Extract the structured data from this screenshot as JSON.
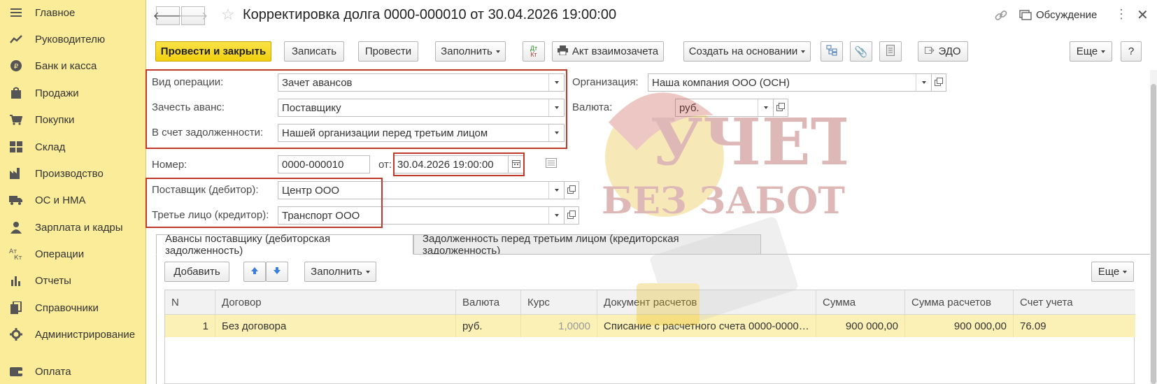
{
  "sidebar": {
    "items": [
      {
        "label": "Главное",
        "icon": "menu-icon"
      },
      {
        "label": "Руководителю",
        "icon": "trend-icon"
      },
      {
        "label": "Банк и касса",
        "icon": "coin-icon"
      },
      {
        "label": "Продажи",
        "icon": "bag-icon"
      },
      {
        "label": "Покупки",
        "icon": "cart-icon"
      },
      {
        "label": "Склад",
        "icon": "warehouse-icon"
      },
      {
        "label": "Производство",
        "icon": "factory-icon"
      },
      {
        "label": "ОС и НМА",
        "icon": "truck-icon"
      },
      {
        "label": "Зарплата и кадры",
        "icon": "person-icon"
      },
      {
        "label": "Операции",
        "icon": "dt-kt-icon"
      },
      {
        "label": "Отчеты",
        "icon": "bar-chart-icon"
      },
      {
        "label": "Справочники",
        "icon": "books-icon"
      },
      {
        "label": "Администрирование",
        "icon": "gear-icon"
      },
      {
        "label": "Оплата",
        "icon": "wallet-icon"
      }
    ]
  },
  "header": {
    "title": "Корректировка долга 0000-000010 от 30.04.2026 19:00:00",
    "discussion": "Обсуждение"
  },
  "toolbar": {
    "post_close": "Провести и закрыть",
    "save": "Записать",
    "post": "Провести",
    "fill": "Заполнить",
    "dtkt": "Дт Кт",
    "offset_act": "Акт взаимозачета",
    "create_based": "Создать на основании",
    "edo": "ЭДО",
    "more": "Еще",
    "help": "?"
  },
  "form": {
    "op_type_label": "Вид операции:",
    "op_type_value": "Зачет авансов",
    "offset_advance_label": "Зачесть аванс:",
    "offset_advance_value": "Поставщику",
    "debt_label": "В счет задолженности:",
    "debt_value": "Нашей организации перед третьим лицом",
    "org_label": "Организация:",
    "org_value": "Наша компания ООО (ОСН)",
    "currency_label": "Валюта:",
    "currency_value": "руб.",
    "number_label": "Номер:",
    "number_value": "0000-000010",
    "date_label": "от:",
    "date_value": "30.04.2026 19:00:00",
    "supplier_label": "Поставщик (дебитор):",
    "supplier_value": "Центр ООО",
    "third_label": "Третье лицо (кредитор):",
    "third_value": "Транспорт ООО"
  },
  "tabs": [
    {
      "label": "Авансы поставщику (дебиторская задолженность)"
    },
    {
      "label": "Задолженность перед третьим лицом (кредиторская задолженность)"
    }
  ],
  "tab_toolbar": {
    "add": "Добавить",
    "fill": "Заполнить",
    "more": "Еще"
  },
  "table": {
    "columns": [
      "N",
      "Договор",
      "Валюта",
      "Курс",
      "Документ расчетов",
      "Сумма",
      "Сумма расчетов",
      "Счет учета"
    ],
    "rows": [
      {
        "n": "1",
        "contract": "Без договора",
        "currency": "руб.",
        "rate": "1,0000",
        "doc": "Списание с расчетного счета 0000-0000…",
        "sum": "900 000,00",
        "settle_sum": "900 000,00",
        "account": "76.09"
      }
    ]
  },
  "watermark": {
    "line1": "УЧЕТ",
    "line2": "БЕЗ ЗАБОТ"
  },
  "colors": {
    "sidebar_bg": "#fbec9a",
    "primary_button": "#f4d31c",
    "highlight_box": "#c0392b",
    "selected_row": "#fbf1b6"
  }
}
